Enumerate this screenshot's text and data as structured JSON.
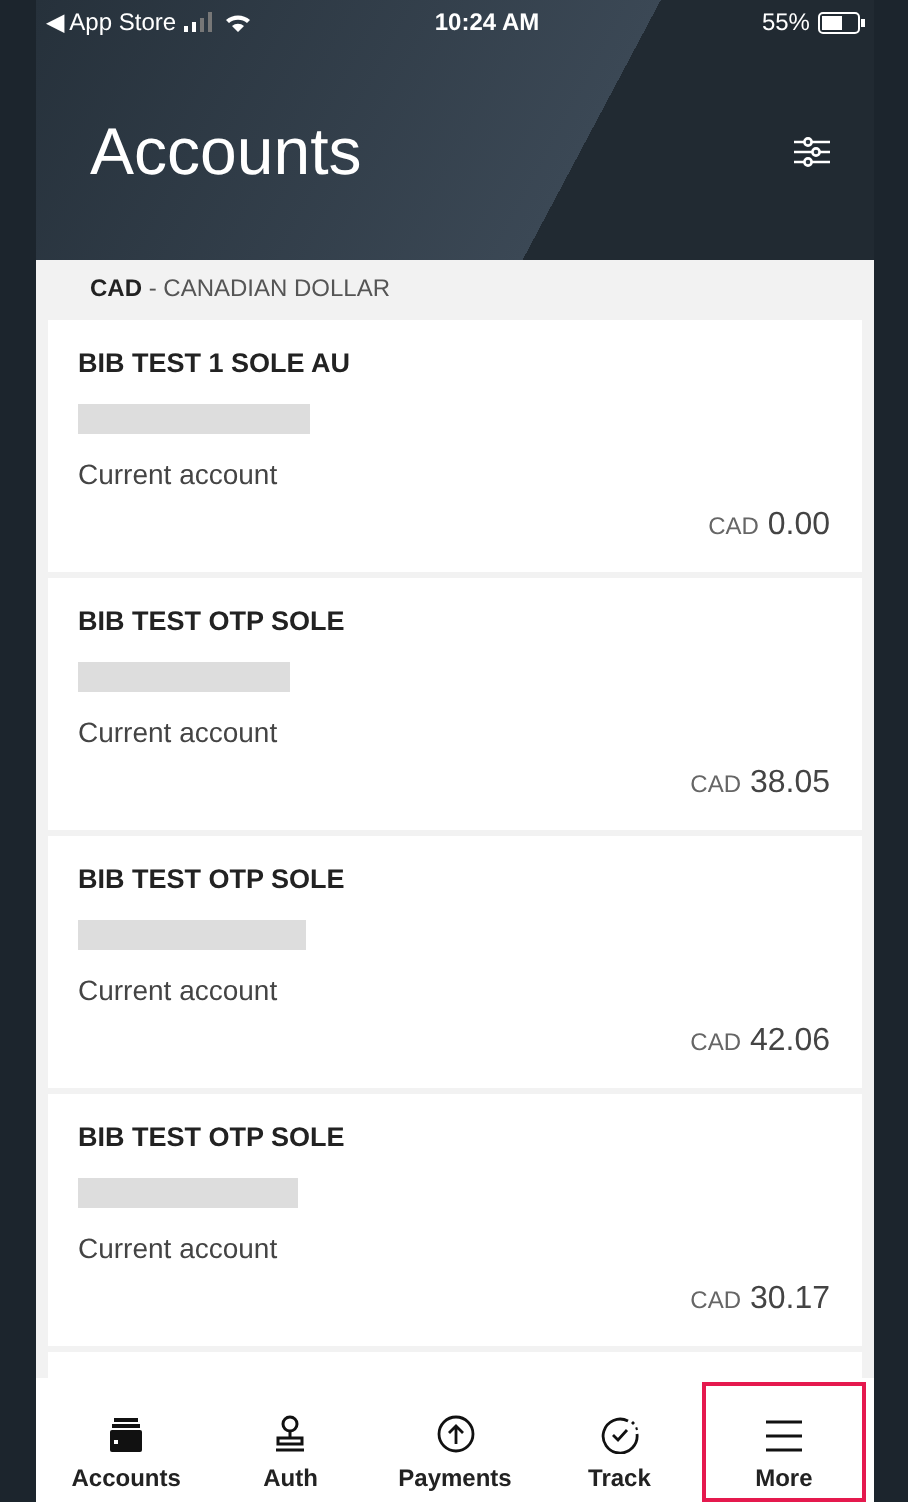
{
  "status_bar": {
    "back_label": "◀ App Store",
    "time": "10:24 AM",
    "battery": "55%"
  },
  "header": {
    "title": "Accounts"
  },
  "currency_group": {
    "code": "CAD",
    "separator": " - ",
    "name": "CANADIAN DOLLAR"
  },
  "accounts": [
    {
      "name": "BIB TEST 1 SOLE AU",
      "type": "Current account",
      "currency": "CAD",
      "balance": "0.00"
    },
    {
      "name": "BIB TEST OTP SOLE",
      "type": "Current account",
      "currency": "CAD",
      "balance": "38.05"
    },
    {
      "name": "BIB TEST OTP SOLE",
      "type": "Current account",
      "currency": "CAD",
      "balance": "42.06"
    },
    {
      "name": "BIB TEST OTP SOLE",
      "type": "Current account",
      "currency": "CAD",
      "balance": "30.17"
    }
  ],
  "tab_bar": [
    {
      "label": "Accounts",
      "highlighted": false
    },
    {
      "label": "Auth",
      "highlighted": false
    },
    {
      "label": "Payments",
      "highlighted": false
    },
    {
      "label": "Track",
      "highlighted": false
    },
    {
      "label": "More",
      "highlighted": true
    }
  ]
}
